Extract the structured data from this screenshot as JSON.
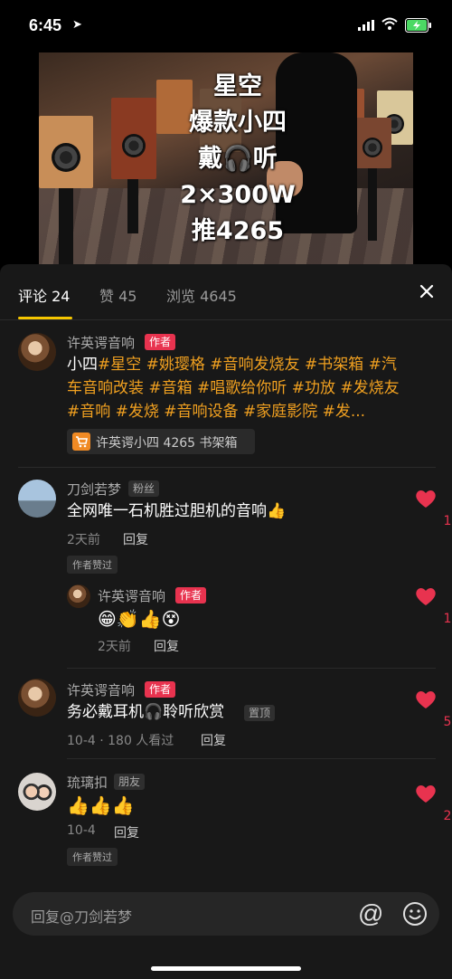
{
  "status_bar": {
    "time": "6:45",
    "location_icon": "location-arrow-icon",
    "signal_icon": "signal-icon",
    "wifi_icon": "wifi-icon",
    "battery_icon": "battery-charging-icon",
    "battery_color": "#4cd964"
  },
  "video": {
    "overlay_lines": [
      "星空",
      "爆款小四",
      "戴🎧听",
      "2×300W",
      "推4265"
    ]
  },
  "tabs": [
    {
      "label": "评论 24",
      "active": true
    },
    {
      "label": "赞 45",
      "active": false
    },
    {
      "label": "浏览 4645",
      "active": false
    }
  ],
  "accent_color": "#f5c600",
  "author_badge_color": "#e8334f",
  "hashtag_color": "#f0a020",
  "post": {
    "user": "许英谔音响",
    "badge": "作者",
    "text_plain": "小四",
    "hashtags": "#星空 #姚璎格 #音响发烧友 #书架箱 #汽车音响改装 #音箱 #唱歌给你听 #功放 #发烧友 #音响 #发烧 #音响设备 #家庭影院 #发...",
    "product": "许英谔小四 4265 书架箱"
  },
  "comments": [
    {
      "user": "刀剑若梦",
      "badge": "粉丝",
      "text": "全网唯一石机胜过胆机的音响👍",
      "time": "2天前",
      "reply": "回复",
      "liked_tag": "作者赞过",
      "likes": "1",
      "sub": {
        "user": "许英谔音响",
        "badge": "作者",
        "text": "😁👏👍😵",
        "time": "2天前",
        "reply": "回复",
        "likes": "1"
      }
    },
    {
      "user": "许英谔音响",
      "badge": "作者",
      "text": "务必戴耳机🎧聆听欣赏",
      "pin": "置顶",
      "time": "10-4 · 180 人看过",
      "reply": "回复",
      "likes": "5"
    },
    {
      "user": "琉璃扣",
      "badge": "朋友",
      "text": "👍👍👍",
      "time": "10-4",
      "reply": "回复",
      "liked_tag": "作者赞过",
      "likes": "2"
    }
  ],
  "input": {
    "placeholder": "回复@刀剑若梦",
    "at_symbol": "@",
    "emoji_icon": "smile-icon"
  }
}
